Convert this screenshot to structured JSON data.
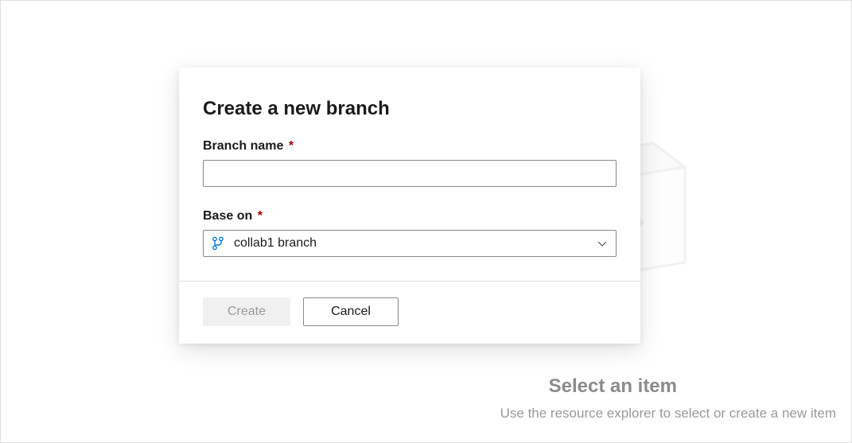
{
  "background": {
    "title": "Select an item",
    "subtitle": "Use the resource explorer to select or create a new item"
  },
  "dialog": {
    "title": "Create a new branch",
    "fields": {
      "branch_name": {
        "label": "Branch name",
        "value": ""
      },
      "base_on": {
        "label": "Base on",
        "selected": "collab1 branch"
      }
    },
    "actions": {
      "create_label": "Create",
      "cancel_label": "Cancel"
    }
  },
  "colors": {
    "accent": "#0078d4",
    "required": "#a80000"
  }
}
